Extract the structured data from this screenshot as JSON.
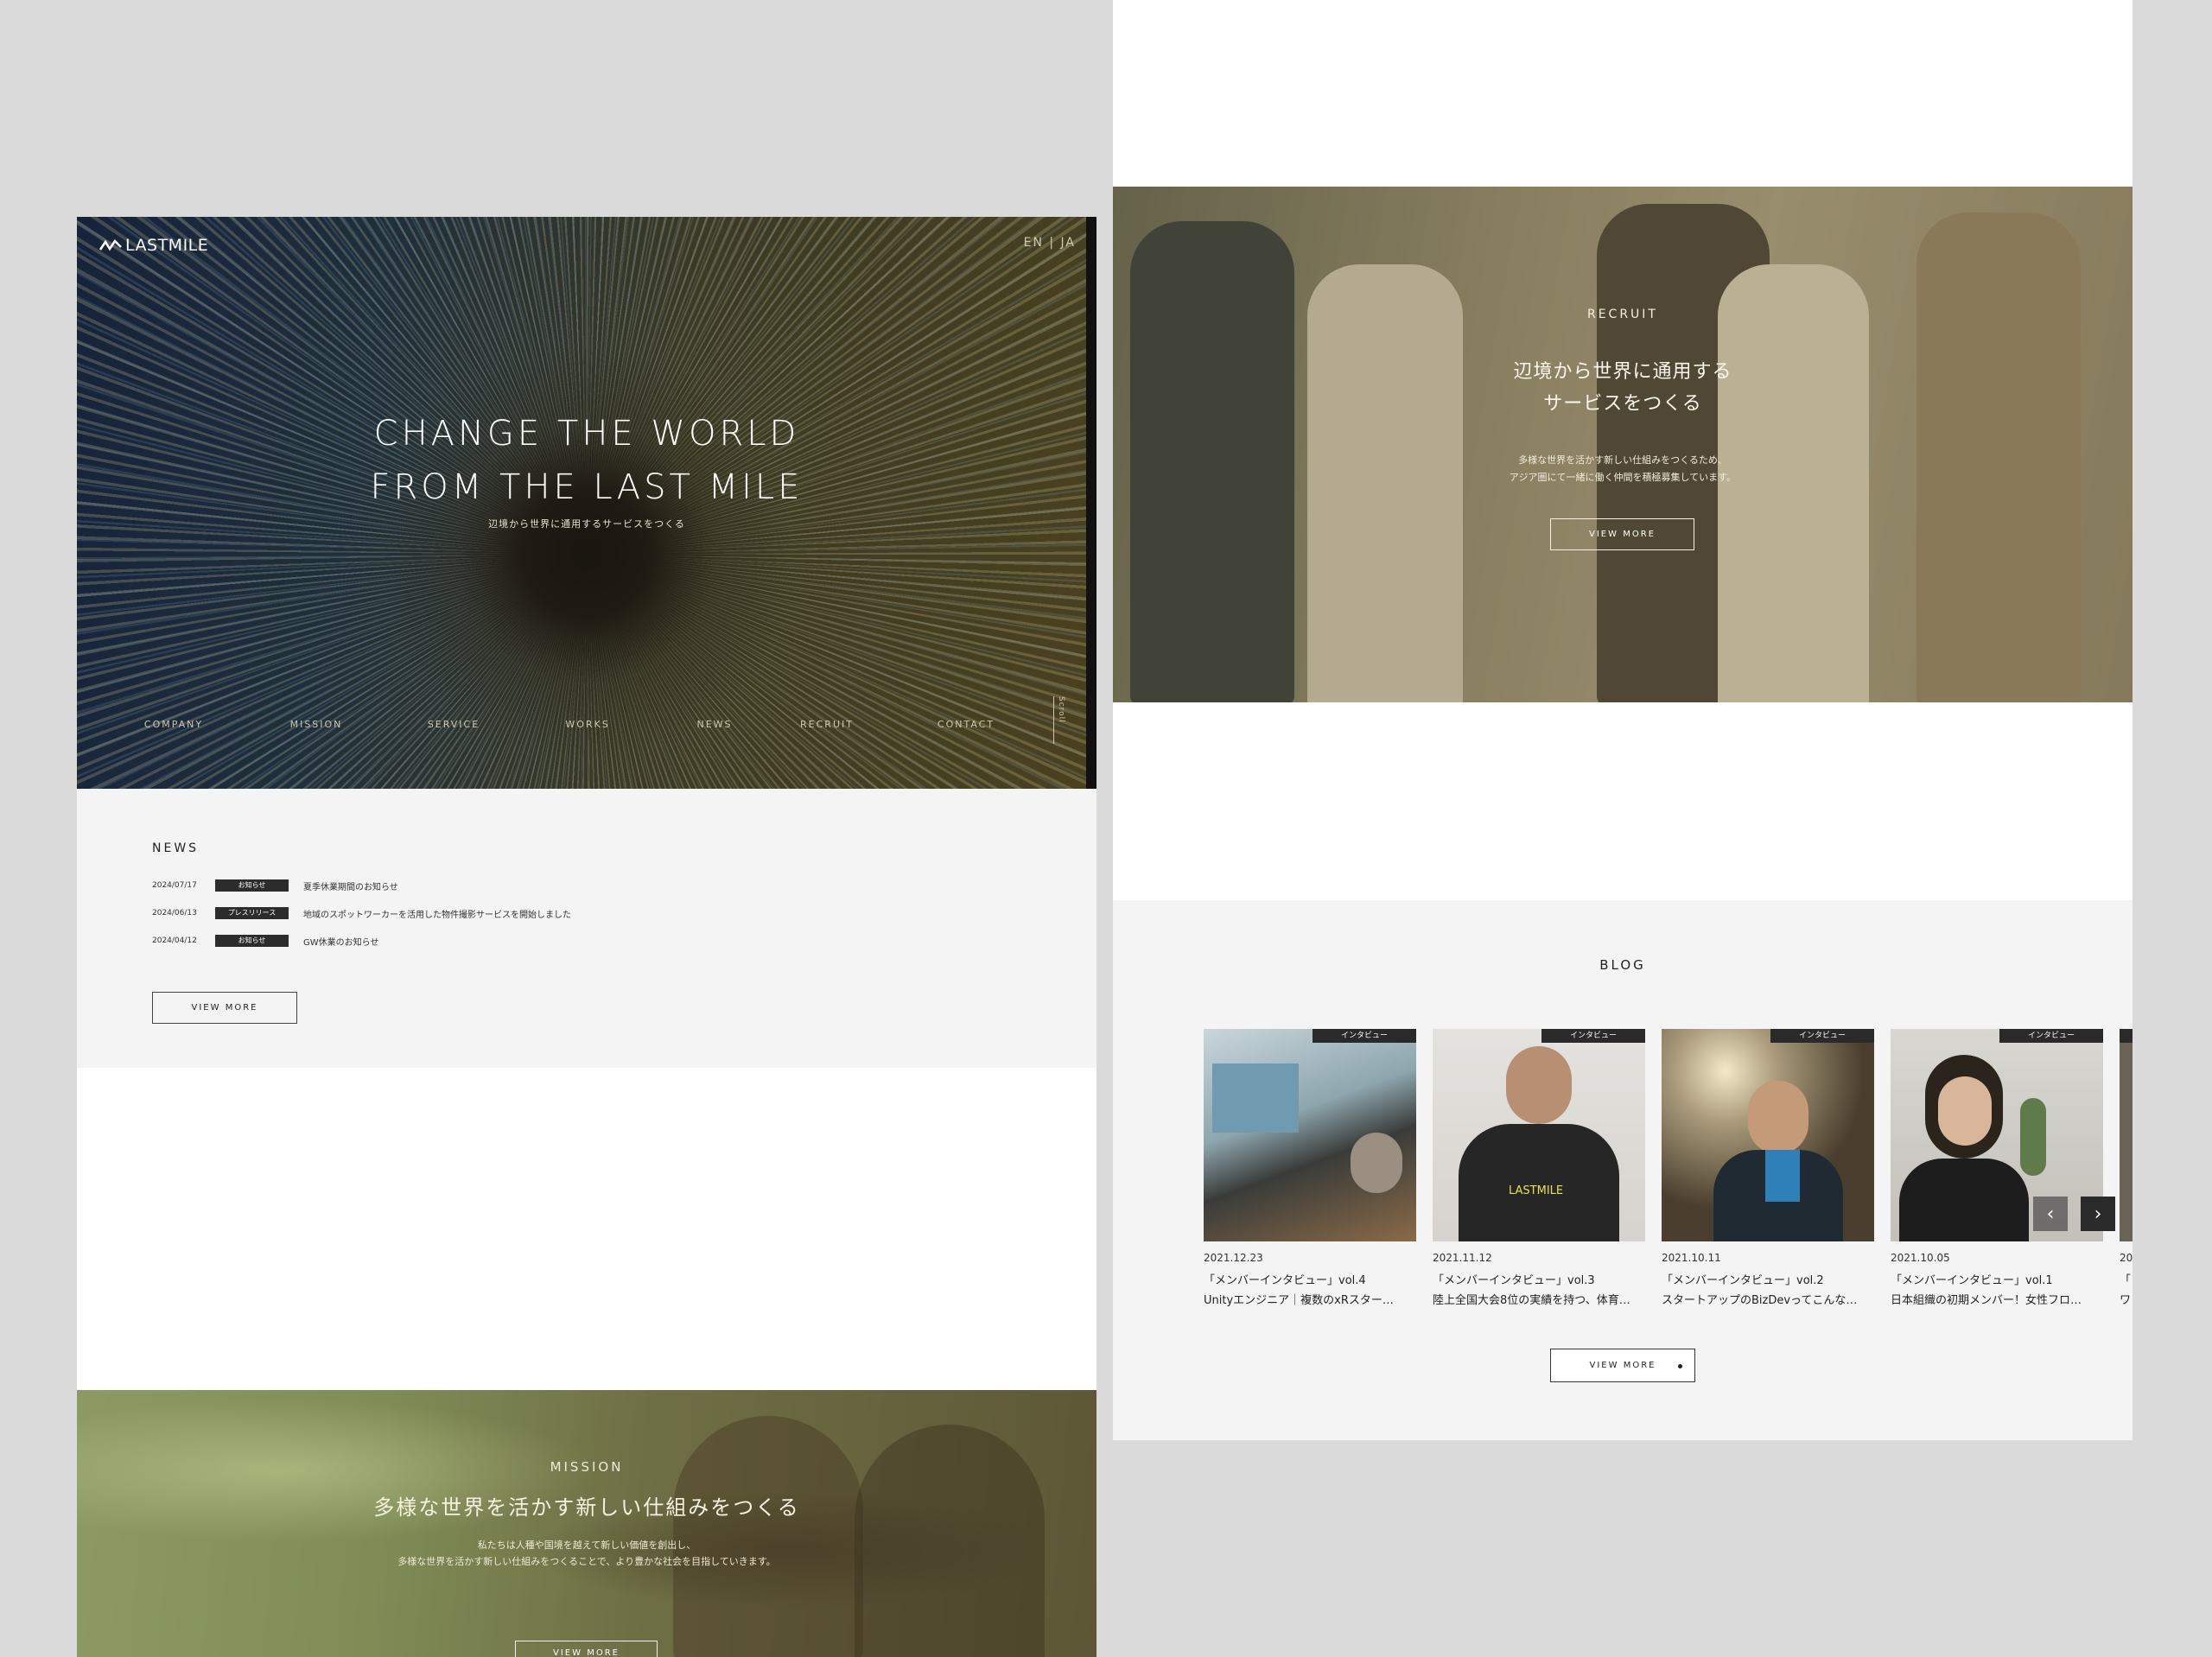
{
  "left": {
    "hero": {
      "logo": "LASTMILE",
      "lang": "EN | JA",
      "title_line1": "CHANGE THE WORLD",
      "title_line2": "FROM THE LAST MILE",
      "subtitle": "辺境から世界に通用するサービスをつくる",
      "nav": [
        "COMPANY",
        "MISSION",
        "SERVICE",
        "WORKS",
        "NEWS",
        "RECRUIT",
        "CONTACT"
      ],
      "scroll": "Scroll"
    },
    "news": {
      "title": "NEWS",
      "items": [
        {
          "date": "2024/07/17",
          "badge": "お知らせ",
          "text": "夏季休業期間のお知らせ"
        },
        {
          "date": "2024/06/13",
          "badge": "プレスリリース",
          "text": "地域のスポットワーカーを活用した物件撮影サービスを開始しました"
        },
        {
          "date": "2024/04/12",
          "badge": "お知らせ",
          "text": "GW休業のお知らせ"
        }
      ],
      "view_more": "VIEW MORE"
    },
    "mission": {
      "label": "MISSION",
      "heading": "多様な世界を活かす新しい仕組みをつくる",
      "body_line1": "私たちは人種や国境を越えて新しい価値を創出し、",
      "body_line2": "多様な世界を活かす新しい仕組みをつくることで、より豊かな社会を目指していきます。",
      "view_more": "VIEW MORE"
    }
  },
  "right": {
    "recruit": {
      "label": "RECRUIT",
      "heading_line1": "辺境から世界に通用する",
      "heading_line2": "サービスをつくる",
      "body_line1": "多様な世界を活かす新しい仕組みをつくるため、",
      "body_line2": "アジア圏にて一緒に働く仲間を積極募集しています。",
      "view_more": "VIEW MORE"
    },
    "blog": {
      "title": "BLOG",
      "posts": [
        {
          "tag": "インタビュー",
          "date": "2021.12.23",
          "title1": "「メンバーインタビュー」vol.4",
          "title2": "Unityエンジニア｜複数のxRスター…"
        },
        {
          "tag": "インタビュー",
          "date": "2021.11.12",
          "title1": "「メンバーインタビュー」vol.3",
          "title2": "陸上全国大会8位の実績を持つ、体育…",
          "shirt_logo": "LASTMILE"
        },
        {
          "tag": "インタビュー",
          "date": "2021.10.11",
          "title1": "「メンバーインタビュー」vol.2",
          "title2": "スタートアップのBizDevってこんな…"
        },
        {
          "tag": "インタビュー",
          "date": "2021.10.05",
          "title1": "「メンバーインタビュー」vol.1",
          "title2": "日本組織の初期メンバー！女性フロ…"
        },
        {
          "tag": "",
          "date": "20",
          "title1": "「",
          "title2": "ワ"
        }
      ],
      "prev": "‹",
      "next": "›",
      "view_more": "VIEW MORE"
    }
  }
}
